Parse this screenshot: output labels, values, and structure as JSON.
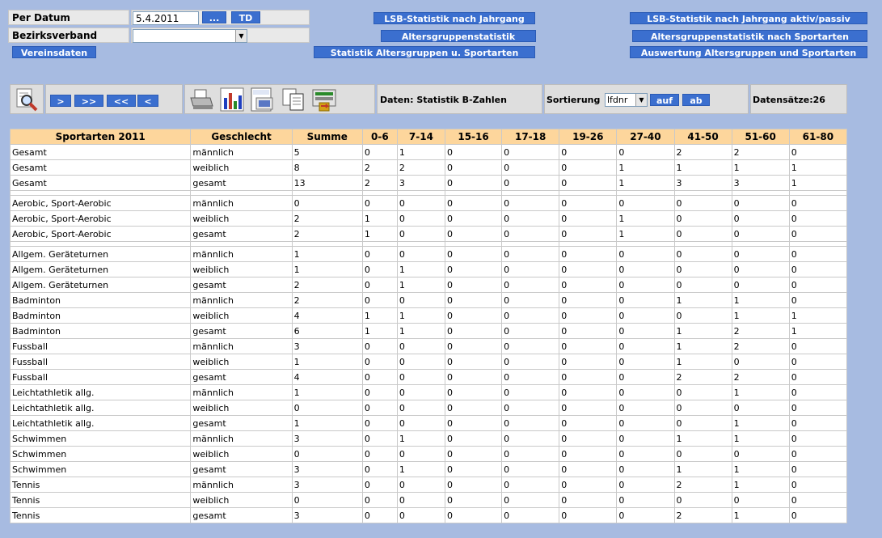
{
  "form": {
    "date_label": "Per Datum",
    "date_value": "5.4.2011",
    "date_picker_label": "...",
    "today_label": "TD",
    "district_label": "Bezirksverband",
    "district_value": "",
    "club_data_label": "Vereinsdaten"
  },
  "stat_buttons": {
    "lsb_year": "LSB-Statistik nach Jahrgang",
    "lsb_year_active": "LSB-Statistik nach Jahrgang  aktiv/passiv",
    "age_groups": "Altersgruppenstatistik",
    "age_groups_sports": "Altersgruppenstatistik nach Sportarten",
    "stat_age_sports": "Statistik Altersgruppen u. Sportarten",
    "eval_age_sports": "Auswertung Altersgruppen und Sportarten"
  },
  "toolbar": {
    "nav": [
      ">",
      ">>",
      "<<",
      "<"
    ],
    "data_label": "Daten: Statistik B-Zahlen",
    "sort_label": "Sortierung",
    "sort_value": "lfdnr",
    "sort_asc": "auf",
    "sort_desc": "ab",
    "records_label": "Datensätze:26",
    "icons": [
      "search-icon",
      "print-icon",
      "chart-icon",
      "office-export-icon",
      "copy-icon",
      "export-icon"
    ]
  },
  "table": {
    "headers": [
      "Sportarten 2011",
      "Geschlecht",
      "Summe",
      "0-6",
      "7-14",
      "15-16",
      "17-18",
      "19-26",
      "27-40",
      "41-50",
      "51-60",
      "61-80"
    ],
    "rows": [
      [
        "Gesamt",
        "männlich",
        "5",
        "0",
        "1",
        "0",
        "0",
        "0",
        "0",
        "2",
        "2",
        "0"
      ],
      [
        "Gesamt",
        "weiblich",
        "8",
        "2",
        "2",
        "0",
        "0",
        "0",
        "1",
        "1",
        "1",
        "1"
      ],
      [
        "Gesamt",
        "gesamt",
        "13",
        "2",
        "3",
        "0",
        "0",
        "0",
        "1",
        "3",
        "3",
        "1"
      ],
      null,
      [
        "Aerobic, Sport-Aerobic",
        "männlich",
        "0",
        "0",
        "0",
        "0",
        "0",
        "0",
        "0",
        "0",
        "0",
        "0"
      ],
      [
        "Aerobic, Sport-Aerobic",
        "weiblich",
        "2",
        "1",
        "0",
        "0",
        "0",
        "0",
        "1",
        "0",
        "0",
        "0"
      ],
      [
        "Aerobic, Sport-Aerobic",
        "gesamt",
        "2",
        "1",
        "0",
        "0",
        "0",
        "0",
        "1",
        "0",
        "0",
        "0"
      ],
      null,
      [
        "Allgem. Geräteturnen",
        "männlich",
        "1",
        "0",
        "0",
        "0",
        "0",
        "0",
        "0",
        "0",
        "0",
        "0"
      ],
      [
        "Allgem. Geräteturnen",
        "weiblich",
        "1",
        "0",
        "1",
        "0",
        "0",
        "0",
        "0",
        "0",
        "0",
        "0"
      ],
      [
        "Allgem. Geräteturnen",
        "gesamt",
        "2",
        "0",
        "1",
        "0",
        "0",
        "0",
        "0",
        "0",
        "0",
        "0"
      ],
      [
        "Badminton",
        "männlich",
        "2",
        "0",
        "0",
        "0",
        "0",
        "0",
        "0",
        "1",
        "1",
        "0"
      ],
      [
        "Badminton",
        "weiblich",
        "4",
        "1",
        "1",
        "0",
        "0",
        "0",
        "0",
        "0",
        "1",
        "1"
      ],
      [
        "Badminton",
        "gesamt",
        "6",
        "1",
        "1",
        "0",
        "0",
        "0",
        "0",
        "1",
        "2",
        "1"
      ],
      [
        "Fussball",
        "männlich",
        "3",
        "0",
        "0",
        "0",
        "0",
        "0",
        "0",
        "1",
        "2",
        "0"
      ],
      [
        "Fussball",
        "weiblich",
        "1",
        "0",
        "0",
        "0",
        "0",
        "0",
        "0",
        "1",
        "0",
        "0"
      ],
      [
        "Fussball",
        "gesamt",
        "4",
        "0",
        "0",
        "0",
        "0",
        "0",
        "0",
        "2",
        "2",
        "0"
      ],
      [
        "Leichtathletik allg.",
        "männlich",
        "1",
        "0",
        "0",
        "0",
        "0",
        "0",
        "0",
        "0",
        "1",
        "0"
      ],
      [
        "Leichtathletik allg.",
        "weiblich",
        "0",
        "0",
        "0",
        "0",
        "0",
        "0",
        "0",
        "0",
        "0",
        "0"
      ],
      [
        "Leichtathletik allg.",
        "gesamt",
        "1",
        "0",
        "0",
        "0",
        "0",
        "0",
        "0",
        "0",
        "1",
        "0"
      ],
      [
        "Schwimmen",
        "männlich",
        "3",
        "0",
        "1",
        "0",
        "0",
        "0",
        "0",
        "1",
        "1",
        "0"
      ],
      [
        "Schwimmen",
        "weiblich",
        "0",
        "0",
        "0",
        "0",
        "0",
        "0",
        "0",
        "0",
        "0",
        "0"
      ],
      [
        "Schwimmen",
        "gesamt",
        "3",
        "0",
        "1",
        "0",
        "0",
        "0",
        "0",
        "1",
        "1",
        "0"
      ],
      [
        "Tennis",
        "männlich",
        "3",
        "0",
        "0",
        "0",
        "0",
        "0",
        "0",
        "2",
        "1",
        "0"
      ],
      [
        "Tennis",
        "weiblich",
        "0",
        "0",
        "0",
        "0",
        "0",
        "0",
        "0",
        "0",
        "0",
        "0"
      ],
      [
        "Tennis",
        "gesamt",
        "3",
        "0",
        "0",
        "0",
        "0",
        "0",
        "0",
        "2",
        "1",
        "0"
      ]
    ]
  }
}
